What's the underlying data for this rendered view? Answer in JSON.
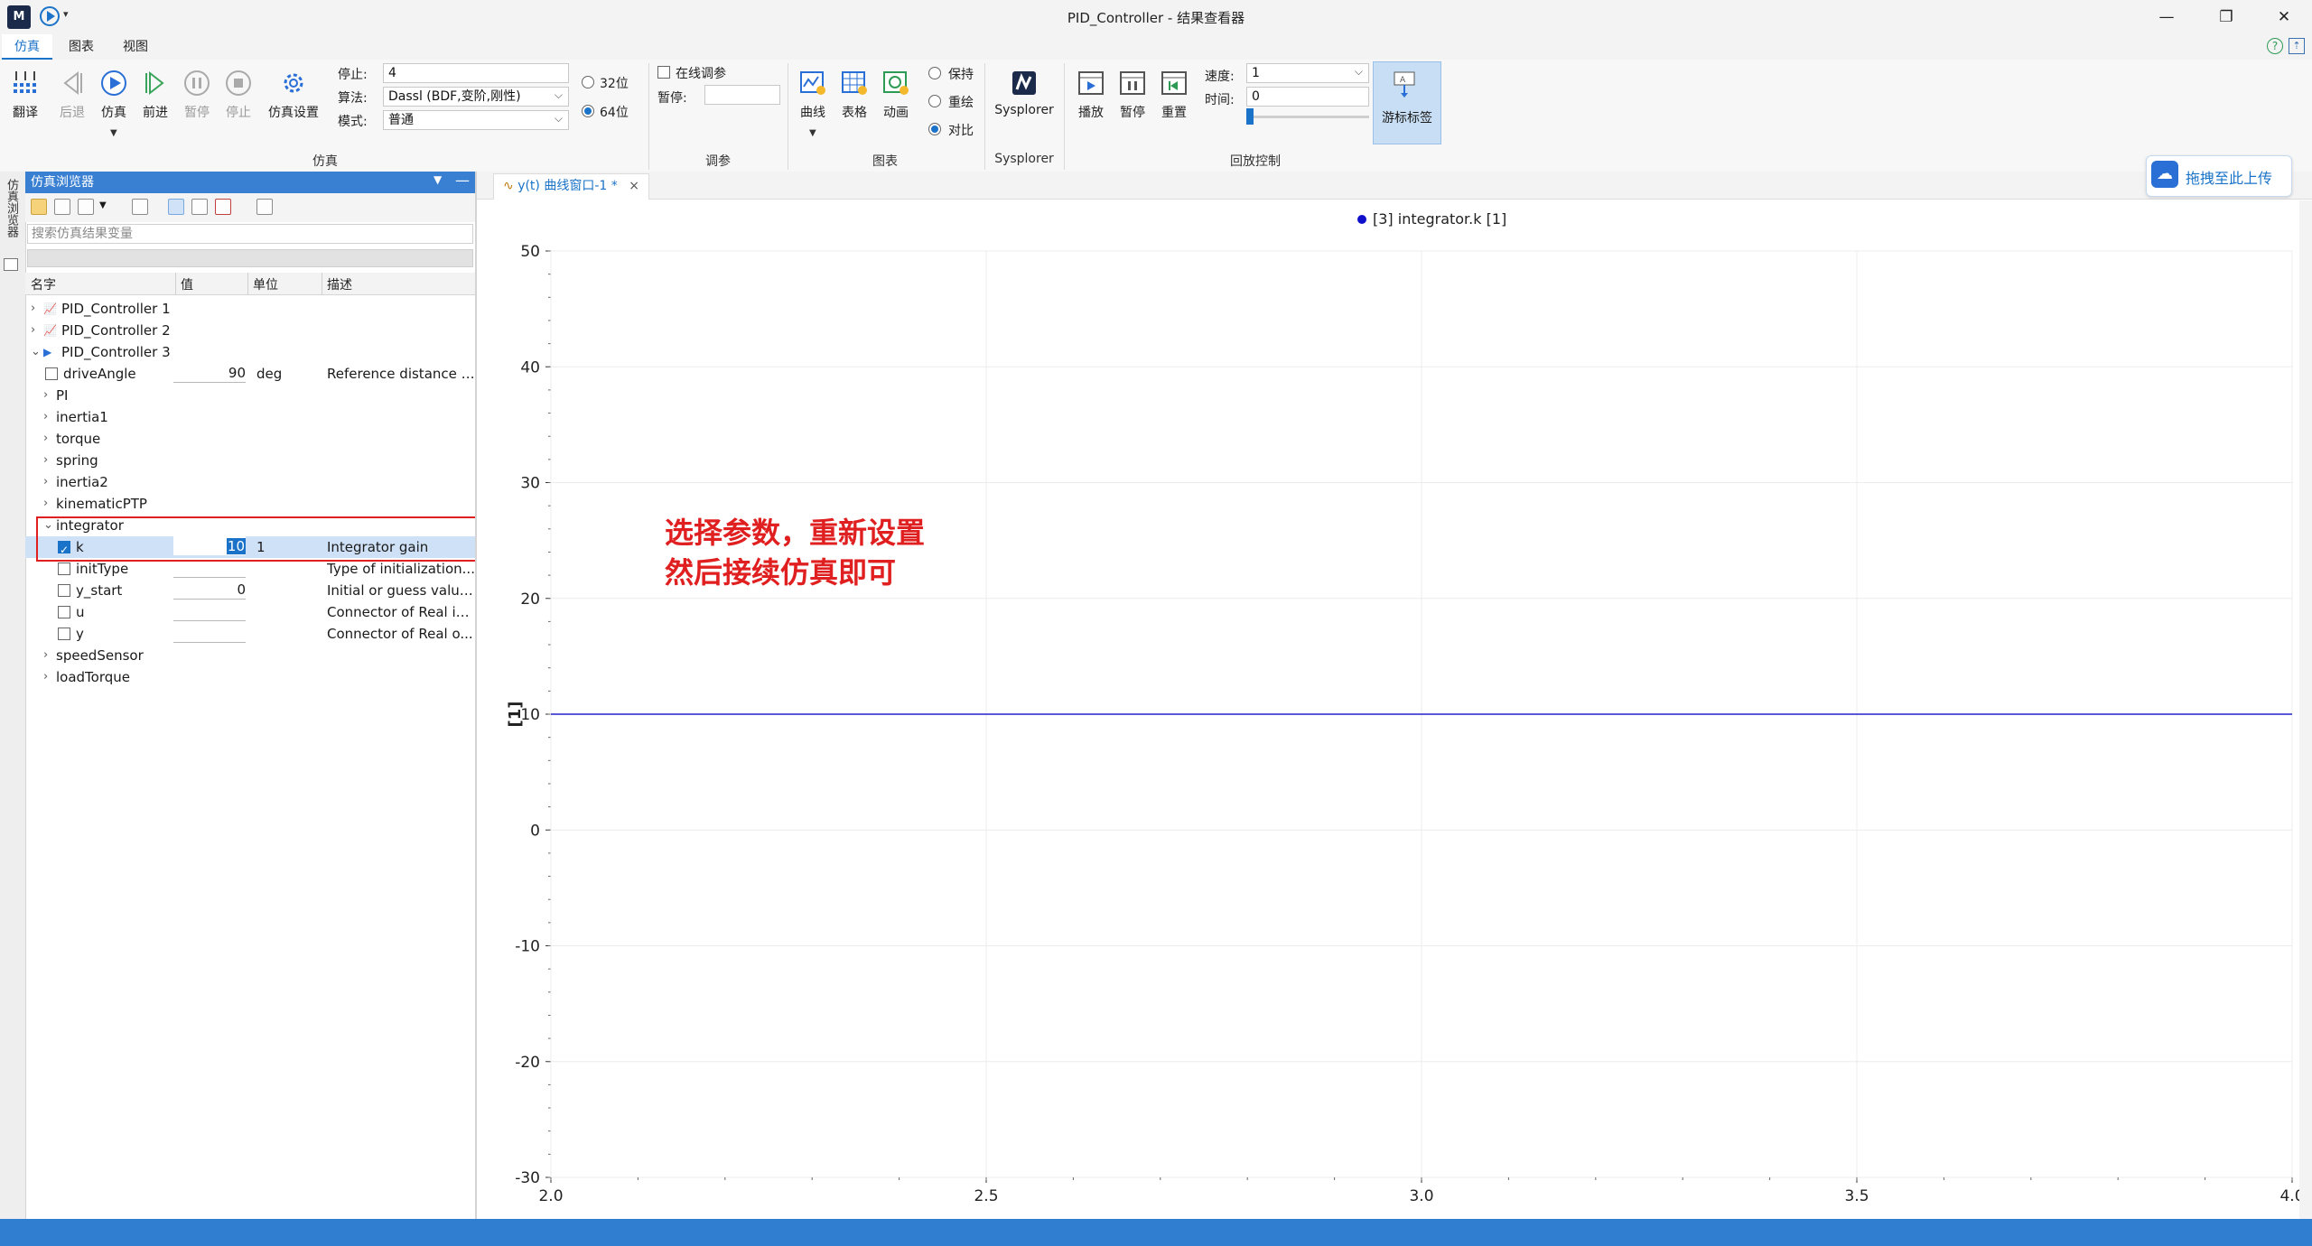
{
  "window": {
    "title": "PID_Controller - 结果查看器",
    "logo": "M",
    "quick_access_dropdown": "▾",
    "minimize": "—",
    "restore": "❐",
    "close": "✕"
  },
  "menu": {
    "tabs": [
      "仿真",
      "图表",
      "视图"
    ],
    "active": "仿真",
    "help_icon": "help-icon"
  },
  "ribbon": {
    "sim_buttons": {
      "translate": "翻译",
      "back": "后退",
      "simulate": "仿真",
      "forward": "前进",
      "pause": "暂停",
      "stop": "停止",
      "sim_settings": "仿真设置"
    },
    "stop_label": "停止:",
    "stop_value": "4",
    "algorithm_label": "算法:",
    "algorithm_value": "Dassl (BDF,变阶,刚性)",
    "mode_label": "模式:",
    "mode_value": "普通",
    "bits_32": "32位",
    "bits_64": "64位",
    "bits_selected": "64位",
    "sim_group": "仿真",
    "online_tuning": "在线调参",
    "pause_label": "暂停:",
    "pause_value": "",
    "tuning_group": "调参",
    "chart_buttons": {
      "curve": "曲线",
      "table": "表格",
      "animation": "动画"
    },
    "chart_group": "图表",
    "keep": "保持",
    "redraw": "重绘",
    "compare": "对比",
    "mode_selected": "对比",
    "sysplorer_button": "Sysplorer",
    "sysplorer_group": "Sysplorer",
    "playback_buttons": {
      "play": "播放",
      "pause": "暂停",
      "reset": "重置"
    },
    "speed_label": "速度:",
    "speed_value": "1",
    "time_label": "时间:",
    "time_value": "0",
    "cursor_label": "游标标签",
    "playback_group": "回放控制"
  },
  "sidebar_strip": {
    "label": "仿真浏览器"
  },
  "browser": {
    "title": "仿真浏览器",
    "search_placeholder": "搜索仿真结果变量",
    "columns": {
      "name": "名字",
      "value": "值",
      "unit": "单位",
      "desc": "描述"
    },
    "rows": [
      {
        "name": "PID_Controller 1",
        "level": 0,
        "chev": "›",
        "icon": "chart-icon"
      },
      {
        "name": "PID_Controller 2",
        "level": 0,
        "chev": "›",
        "icon": "chart-icon"
      },
      {
        "name": "PID_Controller 3",
        "level": 0,
        "chev": "⌄",
        "icon": "play-chart-icon"
      },
      {
        "name": "driveAngle",
        "level": 1,
        "check": false,
        "value": "90",
        "unit": "deg",
        "desc": "Reference distance t..."
      },
      {
        "name": "PI",
        "level": 1,
        "chev": "›"
      },
      {
        "name": "inertia1",
        "level": 1,
        "chev": "›"
      },
      {
        "name": "torque",
        "level": 1,
        "chev": "›"
      },
      {
        "name": "spring",
        "level": 1,
        "chev": "›"
      },
      {
        "name": "inertia2",
        "level": 1,
        "chev": "›"
      },
      {
        "name": "kinematicPTP",
        "level": 1,
        "chev": "›"
      },
      {
        "name": "integrator",
        "level": 1,
        "chev": "⌄"
      },
      {
        "name": "k",
        "level": 2,
        "check": true,
        "value": "10",
        "unit": "1",
        "desc": "Integrator gain",
        "selected": true
      },
      {
        "name": "initType",
        "level": 2,
        "check": false,
        "value": "",
        "unit": "",
        "desc": "Type of initialization..."
      },
      {
        "name": "y_start",
        "level": 2,
        "check": false,
        "value": "0",
        "unit": "",
        "desc": "Initial or guess value..."
      },
      {
        "name": "u",
        "level": 2,
        "check": false,
        "value": "",
        "unit": "",
        "desc": "Connector of Real in..."
      },
      {
        "name": "y",
        "level": 2,
        "check": false,
        "value": "",
        "unit": "",
        "desc": "Connector of Real o..."
      },
      {
        "name": "speedSensor",
        "level": 1,
        "chev": "›"
      },
      {
        "name": "loadTorque",
        "level": 1,
        "chev": "›"
      }
    ]
  },
  "doc_tab": {
    "label": "y(t) 曲线窗口-1 *",
    "close": "×"
  },
  "upload": {
    "label": "拖拽至此上传",
    "icon": "cloud-icon"
  },
  "annotation": {
    "line1": "选择参数，重新设置",
    "line2": "然后接续仿真即可"
  },
  "colors": {
    "accent": "#1a73c8",
    "panel_header": "#3a80d2",
    "highlight_box": "#e02020",
    "series": "#2222cc",
    "status_bar": "#2f7ecf"
  },
  "chart_data": {
    "type": "line",
    "legend": [
      "[3] integrator.k [1]"
    ],
    "legend_position": "top-center",
    "ylabel": "[1]",
    "xlim": [
      2.0,
      4.0
    ],
    "ylim": [
      -30,
      50
    ],
    "x_ticks": [
      "2.0",
      "2.5",
      "3.0",
      "3.5",
      "4.0"
    ],
    "y_ticks": [
      "50",
      "40",
      "30",
      "20",
      "10",
      "0",
      "-10",
      "-20",
      "-30"
    ],
    "x_tick_values": [
      2.0,
      2.5,
      3.0,
      3.5,
      4.0
    ],
    "y_tick_values": [
      50,
      40,
      30,
      20,
      10,
      0,
      -10,
      -20,
      -30
    ],
    "grid": true,
    "series": [
      {
        "name": "[3] integrator.k [1]",
        "x": [
          2.0,
          4.0
        ],
        "y": [
          10,
          10
        ]
      }
    ]
  }
}
